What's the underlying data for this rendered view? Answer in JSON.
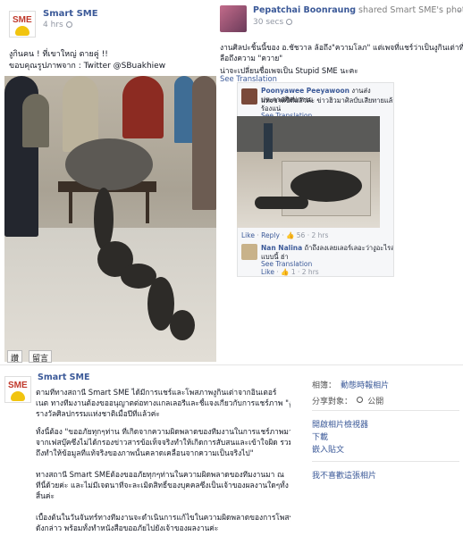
{
  "left_post": {
    "page_name": "Smart SME",
    "time": "4 hrs",
    "caption_line1": "งูกินคน ! ที่เขาใหญ่ ตายคู่ !!",
    "caption_line2": "ขอบคุณรูปภาพจาก : Twitter @SBuakhiew",
    "photo_tags": [
      "讚",
      "留言"
    ],
    "logo_text": "SME"
  },
  "right_post": {
    "user_name": "Pepatchai Boonraung",
    "shared_text": "shared Smart SME's photo.",
    "time": "30 secs",
    "body_line1": "งานศิลปะชิ้นนี้ของ อ.ชัชวาล ล้อถึง\"ความโลภ\" แต่เพจที่แชร์ว่าเป็นงูกินเต่าที่",
    "body_line2": "ลือถึงความ \"ควาย\"",
    "body_line3": "น่าจะเปลี่ยนชื่อเพจเป็น Stupid SME นะคะ",
    "see_translation": "See Translation",
    "comment1": {
      "name": "Poonyawee Peeyawoon",
      "text_line1": "งานส่งประกวดศิลปกรรม",
      "text_line2": "แห่งชาติปีที่แล้วค่ะ ข่าวฮิวมาศิลป์บเสียทายแล้ว ห้อง",
      "text_line3": "ร้องแน่",
      "see_translation": "See Translation"
    },
    "photo_actions": {
      "like": "Like",
      "reply": "Reply",
      "like_count": "56",
      "time": "2 hrs"
    },
    "comment2": {
      "name": "Nan Nalina",
      "text_line1": "ถ้าถึงลงเลยเลอร์เลอะว่างูอะไรลาย",
      "text_line2": "แบบนี้ ฮ่า",
      "see_translation": "See Translation",
      "like": "Like",
      "like_count": "1",
      "time": "2 hrs"
    }
  },
  "bottom_post": {
    "page_name": "Smart SME",
    "logo_text": "SME",
    "paragraph1_line1": "ตามที่ทางสถานี Smart SME ได้มีการแชร์และโพสภาพงูกินเต่าจากอินเตอร์",
    "paragraph1_line2": "เนต ทางทีมงานต้องขออนุญาตต่อทางแกลเลอรีและชี้แจงเกี่ยวกับการแชร์ภาพ \"งูกินเต่า\" ซึ่งเป็นผลงานที่ได้รับ",
    "paragraph1_line3": "รางวัลศิลปกรรมแห่งชาติเมื่อปีที่แล้วค่ะ",
    "paragraph2_line1": "ทั้งนี้ต้อง \"ขออภัยทุกๆท่าน ที่เกิดจากความผิดพลาดของทีมงานในการแชร์ภาพมา",
    "paragraph2_line2": "จากเฟสบุ๊คซึ่งไม่ได้กรองข่าวสารข้อเท็จจริงทำให้เกิดการสับสนและเข้าใจผิด รวม",
    "paragraph2_line3": "ถึงทำให้ข้อมูลที่แท้จริงของภาพนั้นคลาดเคลื่อนจากความเป็นจริงไป\"",
    "paragraph3_line1": "ทางสถานี Smart SMEต้องขออภัยทุกๆท่านในความผิดพลาดของทีมงานมา ณ",
    "paragraph3_line2": "ที่นี้ด้วยค่ะ และไม่มีเจตนาที่จะละเมิดสิทธิ์ของบุคคลซึ่งเป็นเจ้าของผลงานใดๆทั้ง",
    "paragraph3_line3": "สิ้นค่ะ",
    "paragraph4_line1": "เบื้องต้นในวันจันทร์ทางทีมงานจะดำเนินการแก้ไขในความผิดพลาดของการโพสรูป",
    "paragraph4_line2": "ดังกล่าว พร้อมทั้งทำหนังสือขออภัยไปยังเจ้าของผลงานค่ะ"
  },
  "sidebar": {
    "album_label": "相簿：",
    "album_value": "動態時報相片",
    "share_label": "分享對象：",
    "share_value": "公開",
    "links": [
      "開啟相片檢視器",
      "下載",
      "嵌入貼文",
      "我不喜歡這張相片"
    ]
  },
  "colors": {
    "link_blue": "#3b5998",
    "meta_gray": "#9197a3",
    "divider": "#e5e5e5"
  }
}
